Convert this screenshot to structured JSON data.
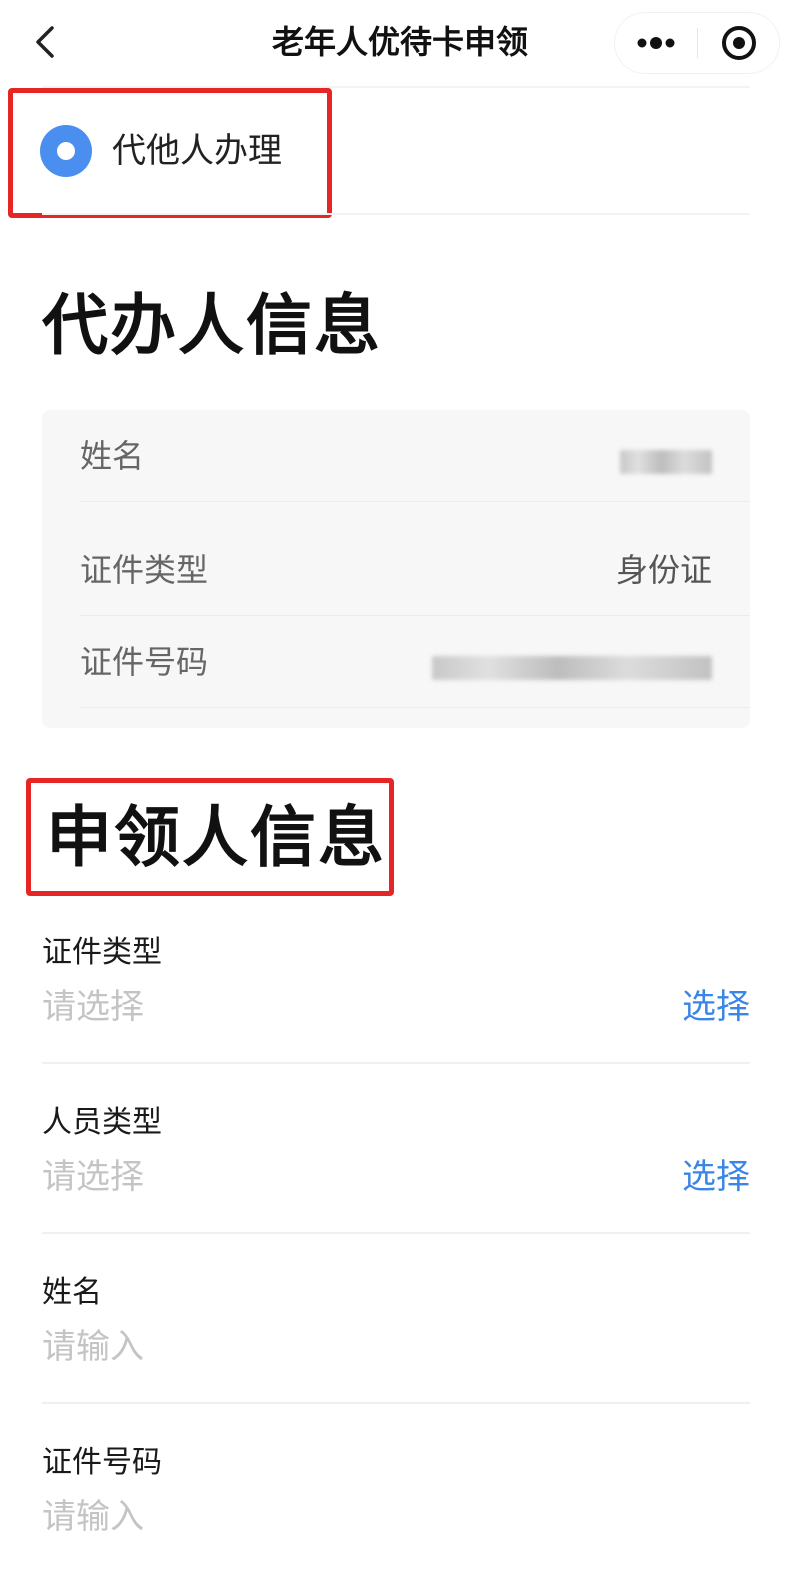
{
  "nav": {
    "title": "老年人优待卡申领",
    "back_icon": "chevron-left-icon",
    "more_icon": "more-dots-icon",
    "close_icon": "target-circle-icon"
  },
  "mode": {
    "label": "代他人办理",
    "selected": true
  },
  "agent_section": {
    "title": "代办人信息",
    "rows": [
      {
        "label": "姓名",
        "value": ""
      },
      {
        "label": "证件类型",
        "value": "身份证"
      },
      {
        "label": "证件号码",
        "value": ""
      }
    ]
  },
  "applicant_section": {
    "title": "申领人信息",
    "fields": [
      {
        "label": "证件类型",
        "placeholder": "请选择",
        "action": "选择"
      },
      {
        "label": "人员类型",
        "placeholder": "请选择",
        "action": "选择"
      },
      {
        "label": "姓名",
        "placeholder": "请输入"
      },
      {
        "label": "证件号码",
        "placeholder": "请输入"
      }
    ]
  },
  "colors": {
    "accent": "#4a8ff0",
    "link": "#3a86e6",
    "annotation_red": "#e52624"
  }
}
